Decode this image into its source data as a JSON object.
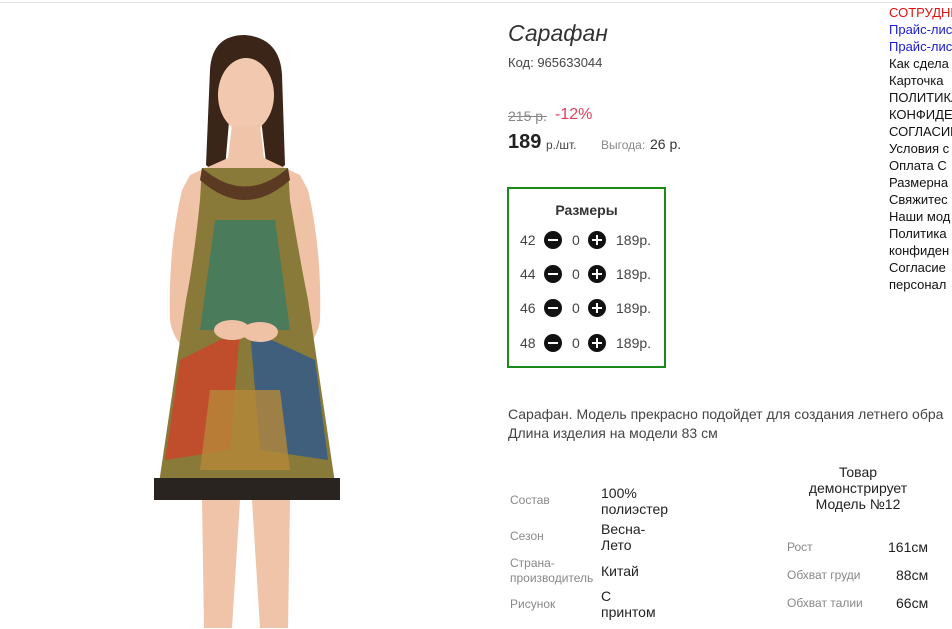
{
  "product": {
    "title": "Сарафан",
    "code": "Код: 965633044",
    "old_price": "215 р.",
    "discount": "-12%",
    "price": "189",
    "price_unit": "р./шт.",
    "saving_label": "Выгода:",
    "saving_value": "26 р."
  },
  "sizes": {
    "title": "Размеры",
    "rows": [
      {
        "size": "42",
        "qty": "0",
        "price": "189р."
      },
      {
        "size": "44",
        "qty": "0",
        "price": "189р."
      },
      {
        "size": "46",
        "qty": "0",
        "price": "189р."
      },
      {
        "size": "48",
        "qty": "0",
        "price": "189р."
      }
    ]
  },
  "description": {
    "line1": "Сарафан. Модель прекрасно подойдет для создания летнего обра",
    "line2": "Длина изделия на модели 83 см"
  },
  "specs": [
    {
      "label": "Состав",
      "value_lines": [
        "100%",
        "полиэстер"
      ]
    },
    {
      "label": "Сезон",
      "value_lines": [
        "Весна-",
        "Лето"
      ]
    },
    {
      "label_lines": [
        "Страна-",
        "производитель"
      ],
      "value_lines": [
        "Китай"
      ]
    },
    {
      "label": "Рисунок",
      "value_lines": [
        "С",
        "принтом"
      ]
    }
  ],
  "model": {
    "heading_lines": [
      "Товар",
      "демонстрирует",
      "Модель №12"
    ],
    "measurements": [
      {
        "label": "Рост",
        "value": "161см"
      },
      {
        "label": "Обхват груди",
        "value": "88см"
      },
      {
        "label": "Обхват талии",
        "value": "66см"
      }
    ]
  },
  "side_links": [
    {
      "text": "СОТРУДНИ",
      "color": "red"
    },
    {
      "text": "Прайс-лис",
      "color": "blue"
    },
    {
      "text": "Прайс-лис",
      "color": "blue"
    },
    {
      "text": "Как сдела",
      "color": "dark"
    },
    {
      "text": "Карточка",
      "color": "dark"
    },
    {
      "text": "ПОЛИТИКА",
      "color": "dark"
    },
    {
      "text": "КОНФИДЕ",
      "color": "dark"
    },
    {
      "text": "СОГЛАСИЕ",
      "color": "dark"
    },
    {
      "text": "Условия с",
      "color": "dark"
    },
    {
      "text": "Оплата С",
      "color": "dark"
    },
    {
      "text": "Размерна",
      "color": "dark"
    },
    {
      "text": "Свяжитес",
      "color": "dark"
    },
    {
      "text": "Наши мод",
      "color": "dark"
    },
    {
      "text": "Политика",
      "color": "dark"
    },
    {
      "text": "конфиден",
      "color": "dark"
    },
    {
      "text": "Согласие",
      "color": "dark"
    },
    {
      "text": "персонал",
      "color": "dark"
    }
  ]
}
